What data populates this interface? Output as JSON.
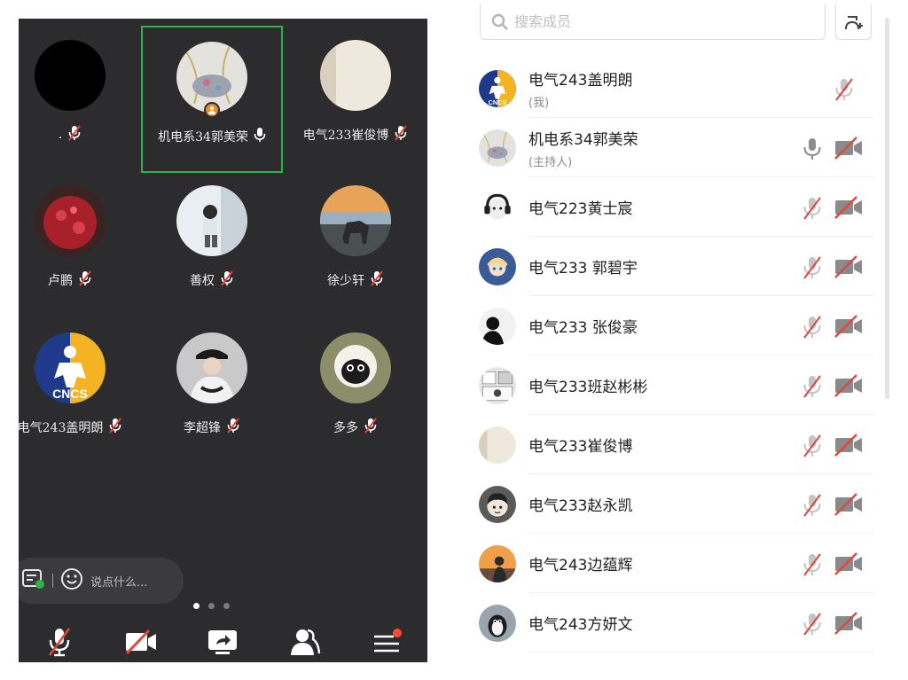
{
  "video_grid": {
    "tiles": [
      {
        "name": ".",
        "mic": "mic-muted",
        "active": false,
        "host": false,
        "avatar": "black"
      },
      {
        "name": "机电系34郭美荣",
        "mic": "mic-on",
        "active": true,
        "host": true,
        "avatar": "jewelry"
      },
      {
        "name": "电气233崔俊博",
        "mic": "mic-muted",
        "active": false,
        "host": false,
        "avatar": "cream"
      },
      {
        "name": "卢鹏",
        "mic": "mic-muted",
        "active": false,
        "host": false,
        "avatar": "red"
      },
      {
        "name": "善权",
        "mic": "mic-muted",
        "active": false,
        "host": false,
        "avatar": "person"
      },
      {
        "name": "徐少轩",
        "mic": "mic-muted",
        "active": false,
        "host": false,
        "avatar": "sunset-horse"
      },
      {
        "name": "电气243盖明朗",
        "mic": "mic-muted",
        "active": false,
        "host": false,
        "avatar": "cncs"
      },
      {
        "name": "李超锋",
        "mic": "mic-muted",
        "active": false,
        "host": false,
        "avatar": "cap-person"
      },
      {
        "name": "多多",
        "mic": "mic-muted",
        "active": false,
        "host": false,
        "avatar": "sheep"
      }
    ],
    "chat_placeholder": "说点什么...",
    "pager": {
      "pages": 3,
      "current": 1
    }
  },
  "toolbar": {
    "items": [
      "mic-muted-icon",
      "camera-off-icon",
      "share-screen-icon",
      "members-icon",
      "more-menu-icon"
    ],
    "menu_has_notification": true
  },
  "members_panel": {
    "search_placeholder": "搜索成员",
    "members": [
      {
        "name": "电气243盖明朗",
        "role": "(我)",
        "mic": "muted",
        "camera": "none",
        "avatar": "cncs"
      },
      {
        "name": "机电系34郭美荣",
        "role": "(主持人)",
        "mic": "on",
        "camera": "off",
        "avatar": "jewelry"
      },
      {
        "name": "电气223黄士宸",
        "role": "",
        "mic": "muted",
        "camera": "off",
        "avatar": "cat-headphones"
      },
      {
        "name": "电气233 郭碧宇",
        "role": "",
        "mic": "muted",
        "camera": "off",
        "avatar": "anime-blue"
      },
      {
        "name": "电气233 张俊豪",
        "role": "",
        "mic": "muted",
        "camera": "off",
        "avatar": "dark-silhouette"
      },
      {
        "name": "电气233班赵彬彬",
        "role": "",
        "mic": "muted",
        "camera": "off",
        "avatar": "manga"
      },
      {
        "name": "电气233崔俊博",
        "role": "",
        "mic": "muted",
        "camera": "off",
        "avatar": "cream"
      },
      {
        "name": "电气233赵永凯",
        "role": "",
        "mic": "muted",
        "camera": "off",
        "avatar": "cartoon-boy"
      },
      {
        "name": "电气243边蕴辉",
        "role": "",
        "mic": "muted",
        "camera": "off",
        "avatar": "sunset-silhouette"
      },
      {
        "name": "电气243方妍文",
        "role": "",
        "mic": "muted",
        "camera": "off",
        "avatar": "penguin"
      }
    ]
  },
  "colors": {
    "grid_background": "#2c2c2e",
    "active_speaker_border": "#2bb34a",
    "host_badge": "#f08a24",
    "muted_red": "#e0473c",
    "notification_dot": "#ff4a3a"
  }
}
